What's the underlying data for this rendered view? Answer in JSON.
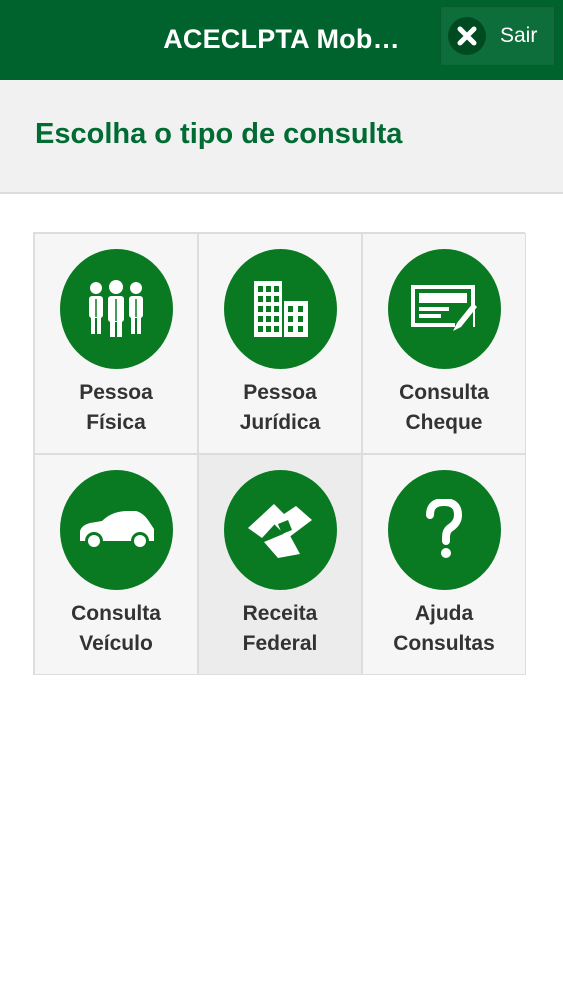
{
  "header": {
    "title": "ACECLPTA Mob…",
    "exit_label": "Sair"
  },
  "subheader": {
    "title": "Escolha o tipo de consulta"
  },
  "tiles": [
    {
      "line1": "Pessoa",
      "line2": "Física",
      "icon": "people-icon"
    },
    {
      "line1": "Pessoa",
      "line2": "Jurídica",
      "icon": "buildings-icon"
    },
    {
      "line1": "Consulta",
      "line2": "Cheque",
      "icon": "check-icon"
    },
    {
      "line1": "Consulta",
      "line2": "Veículo",
      "icon": "car-icon"
    },
    {
      "line1": "Receita",
      "line2": "Federal",
      "icon": "receita-federal-logo-icon"
    },
    {
      "line1": "Ajuda",
      "line2": "Consultas",
      "icon": "question-mark-icon"
    }
  ],
  "colors": {
    "header_bg": "#00622d",
    "accent": "#006b32",
    "icon_circle": "#0a7a22"
  }
}
